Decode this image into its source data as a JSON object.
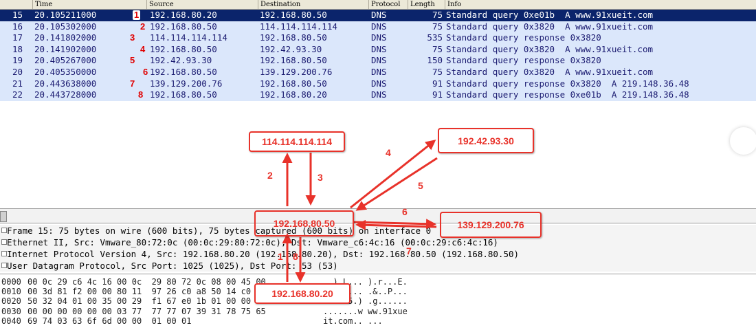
{
  "packet_list": {
    "columns": [
      "Time",
      "Source",
      "Destination",
      "Protocol",
      "Length",
      "Info"
    ],
    "rows": [
      {
        "no": "15",
        "time": "20.105211000",
        "step": "1",
        "source": "192.168.80.20",
        "destination": "192.168.80.50",
        "protocol": "DNS",
        "length": "75",
        "info": "Standard query 0xe01b  A www.91xueit.com"
      },
      {
        "no": "16",
        "time": "20.105302000",
        "step": "2",
        "source": "192.168.80.50",
        "destination": "114.114.114.114",
        "protocol": "DNS",
        "length": "75",
        "info": "Standard query 0x3820  A www.91xueit.com"
      },
      {
        "no": "17",
        "time": "20.141802000",
        "step": "3",
        "source": "114.114.114.114",
        "destination": "192.168.80.50",
        "protocol": "DNS",
        "length": "535",
        "info": "Standard query response 0x3820"
      },
      {
        "no": "18",
        "time": "20.141902000",
        "step": "4",
        "source": "192.168.80.50",
        "destination": "192.42.93.30",
        "protocol": "DNS",
        "length": "75",
        "info": "Standard query 0x3820  A www.91xueit.com"
      },
      {
        "no": "19",
        "time": "20.405267000",
        "step": "5",
        "source": "192.42.93.30",
        "destination": "192.168.80.50",
        "protocol": "DNS",
        "length": "150",
        "info": "Standard query response 0x3820"
      },
      {
        "no": "20",
        "time": "20.405350000",
        "step": "6",
        "source": "192.168.80.50",
        "destination": "139.129.200.76",
        "protocol": "DNS",
        "length": "75",
        "info": "Standard query 0x3820  A www.91xueit.com"
      },
      {
        "no": "21",
        "time": "20.443638000",
        "step": "7",
        "source": "139.129.200.76",
        "destination": "192.168.80.50",
        "protocol": "DNS",
        "length": "91",
        "info": "Standard query response 0x3820  A 219.148.36.48"
      },
      {
        "no": "22",
        "time": "20.443728000",
        "step": "8",
        "source": "192.168.80.50",
        "destination": "192.168.80.20",
        "protocol": "DNS",
        "length": "91",
        "info": "Standard query response 0xe01b  A 219.148.36.48"
      }
    ]
  },
  "details": {
    "frame": "Frame 15: 75 bytes on wire (600 bits), 75 bytes captured (600 bits) on interface 0",
    "ethernet": "Ethernet II, Src: Vmware_80:72:0c (00:0c:29:80:72:0c), Dst: Vmware_c6:4c:16 (00:0c:29:c6:4c:16)",
    "ip": "Internet Protocol Version 4, Src: 192.168.80.20 (192.168.80.20), Dst: 192.168.80.50 (192.168.80.50)",
    "udp": "User Datagram Protocol, Src Port: 1025 (1025), Dst Port: 53 (53)"
  },
  "hex": [
    {
      "offset": "0000",
      "bytes": "00 0c 29 c6 4c 16 00 0c  29 80 72 0c 08 00 45 00",
      "ascii": "..).L... ).r...E."
    },
    {
      "offset": "0010",
      "bytes": "00 3d 81 f2 00 00 80 11  97 26 c0 a8 50 14 c0 a8",
      "ascii": ".=...... .&..P..."
    },
    {
      "offset": "0020",
      "bytes": "50 32 04 01 00 35 00 29  f1 67 e0 1b 01 00 00 01",
      "ascii": "P2...5.) .g......"
    },
    {
      "offset": "0030",
      "bytes": "00 00 00 00 00 00 03 77  77 77 07 39 31 78 75 65",
      "ascii": ".......w ww.91xue"
    },
    {
      "offset": "0040",
      "bytes": "69 74 03 63 6f 6d 00 00  01 00 01",
      "ascii": "it.com.. ..."
    }
  ],
  "annotation": {
    "hosts": {
      "root": "114.114.114.114",
      "gtld": "192.42.93.30",
      "local_dns": "192.168.80.50",
      "authoritative": "139.129.200.76",
      "client": "192.168.80.20"
    },
    "step_labels": [
      "1",
      "2",
      "3",
      "4",
      "5",
      "6",
      "7",
      "8"
    ],
    "arrow_color": "#e8322a"
  }
}
